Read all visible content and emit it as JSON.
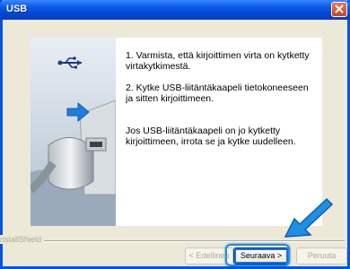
{
  "window": {
    "title": "USB"
  },
  "instructions": {
    "step1": "1. Varmista, että kirjoittimen virta on kytketty virtakytkimestä.",
    "step2": "2. Kytke USB-liitäntäkaapeli tietokoneeseen ja sitten kirjoittimeen.",
    "note": "Jos USB-liitäntäkaapeli on jo kytketty kirjoittimeen, irrota se ja kytke uudelleen."
  },
  "footer": {
    "brand": "nstallShield",
    "buttons": {
      "back": "< Edellinen",
      "next": "Seuraava >",
      "cancel": "Peruuta"
    }
  },
  "icons": {
    "close": "close-icon",
    "usb": "usb-symbol-icon",
    "connect_arrow": "connect-arrow-icon",
    "pointer_arrow": "pointer-arrow-icon"
  },
  "colors": {
    "titlebar": "#0a5be6",
    "dialog_bg": "#ece9d8",
    "accent_arrow": "#1f8fe6",
    "close_button": "#d3542f"
  }
}
